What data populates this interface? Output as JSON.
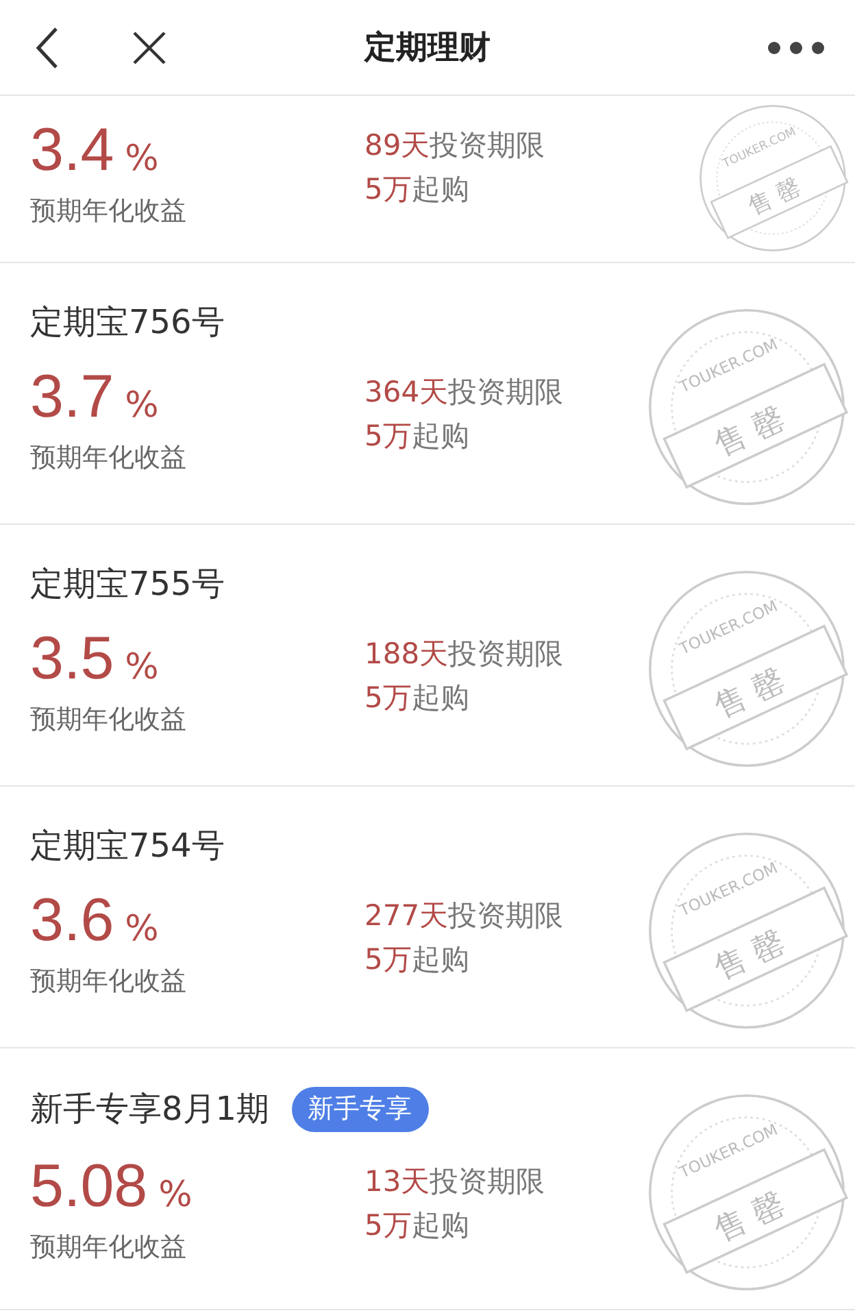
{
  "header": {
    "title": "定期理财"
  },
  "products": [
    {
      "rate": "3.4",
      "unit": "%",
      "rate_label": "预期年化收益",
      "term_value": "89天",
      "term_label": "投资期限",
      "min_value": "5万",
      "min_label": "起购",
      "sold_out": true,
      "stamp_brand": "TOUKER.COM",
      "stamp_text": "售 罄"
    },
    {
      "title": "定期宝756号",
      "rate": "3.7",
      "unit": "%",
      "rate_label": "预期年化收益",
      "term_value": "364天",
      "term_label": "投资期限",
      "min_value": "5万",
      "min_label": "起购",
      "sold_out": true,
      "stamp_brand": "TOUKER.COM",
      "stamp_text": "售 罄"
    },
    {
      "title": "定期宝755号",
      "rate": "3.5",
      "unit": "%",
      "rate_label": "预期年化收益",
      "term_value": "188天",
      "term_label": "投资期限",
      "min_value": "5万",
      "min_label": "起购",
      "sold_out": true,
      "stamp_brand": "TOUKER.COM",
      "stamp_text": "售 罄"
    },
    {
      "title": "定期宝754号",
      "rate": "3.6",
      "unit": "%",
      "rate_label": "预期年化收益",
      "term_value": "277天",
      "term_label": "投资期限",
      "min_value": "5万",
      "min_label": "起购",
      "sold_out": true,
      "stamp_brand": "TOUKER.COM",
      "stamp_text": "售 罄"
    },
    {
      "title": "新手专享8月1期",
      "tag": "新手专享",
      "rate": "5.08",
      "unit": "%",
      "rate_label": "预期年化收益",
      "term_value": "13天",
      "term_label": "投资期限",
      "min_value": "5万",
      "min_label": "起购",
      "sold_out": true,
      "stamp_brand": "TOUKER.COM",
      "stamp_text": "售 罄"
    }
  ]
}
